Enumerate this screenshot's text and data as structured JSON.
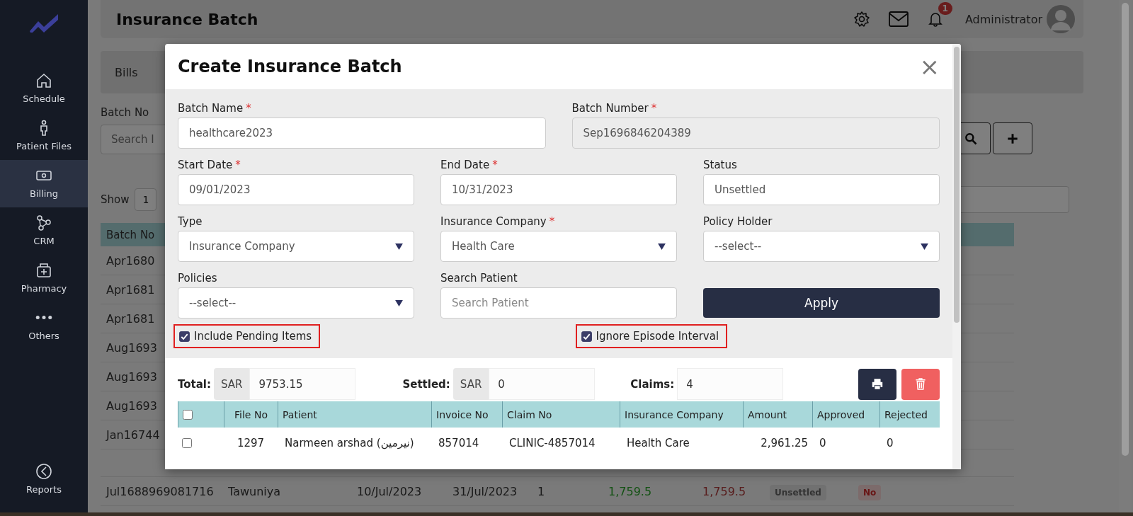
{
  "sidebar": {
    "items": [
      {
        "label": "Schedule",
        "selected": false
      },
      {
        "label": "Patient Files",
        "selected": false
      },
      {
        "label": "Billing",
        "selected": true
      },
      {
        "label": "CRM",
        "selected": false
      },
      {
        "label": "Pharmacy",
        "selected": false
      },
      {
        "label": "Others",
        "selected": false
      }
    ],
    "bottom_item": {
      "label": "Reports",
      "selected": false
    }
  },
  "header": {
    "title": "Insurance Batch",
    "notification_count": "1",
    "user": "Administrator"
  },
  "page": {
    "tab": "Bills",
    "filter_label": "Batch No",
    "search_placeholder": "Search I",
    "show_label": "Show",
    "show_value": "1",
    "table": {
      "column": "Batch No",
      "rows": [
        "Apr1680",
        "Apr1681",
        "Apr1681",
        "Aug1693",
        "Aug1693",
        "Aug1693",
        "Jan16744"
      ],
      "last_row": {
        "batch_no": "Jul1688969081716",
        "company": "Tawuniya",
        "start": "10/Jul/2023",
        "end": "31/Jul/2023",
        "claims": "1",
        "amount": "1,759.5",
        "approved": "1,759.5",
        "status": "Unsettled",
        "settled": "No"
      }
    }
  },
  "modal": {
    "title": "Create Insurance Batch",
    "close": "×",
    "rows": [
      [
        {
          "kind": "text",
          "label": "Batch Name",
          "required_mark": "*",
          "value": "healthcare2023"
        },
        {
          "kind": "disabled",
          "label": "Batch Number",
          "required_mark": "*",
          "value": "Sep1696846204389"
        }
      ],
      [
        {
          "kind": "text",
          "label": "Start Date",
          "required_mark": "*",
          "value": "09/01/2023"
        },
        {
          "kind": "text",
          "label": "End Date",
          "required_mark": "*",
          "value": "10/31/2023"
        },
        {
          "kind": "text",
          "label": "Status",
          "value": "Unsettled"
        }
      ],
      [
        {
          "kind": "select",
          "label": "Type",
          "value": "Insurance Company"
        },
        {
          "kind": "select",
          "label": "Insurance Company",
          "required_mark": "*",
          "value": "Health Care"
        },
        {
          "kind": "select",
          "label": "Policy Holder",
          "value": "--select--"
        }
      ],
      [
        {
          "kind": "select",
          "label": "Policies",
          "value": "--select--"
        },
        {
          "kind": "search",
          "label": "Search Patient",
          "placeholder": "Search Patient"
        },
        {
          "kind": "button",
          "label": "Apply"
        }
      ]
    ],
    "checkboxes": [
      {
        "label": "Include Pending Items",
        "checked": true,
        "highlighted": true
      },
      {
        "label": "Ignore Episode Interval",
        "checked": true,
        "highlighted": true
      }
    ],
    "totals": {
      "total_label": "Total:",
      "total_currency": "SAR",
      "total": "9753.15",
      "settled_label": "Settled:",
      "settled_currency": "SAR",
      "settled": "0",
      "claims_label": "Claims:",
      "claims": "4"
    },
    "table": {
      "select_all": false,
      "columns": [
        "File No",
        "Patient",
        "Invoice No",
        "Claim No",
        "Insurance Company",
        "Amount",
        "Approved",
        "Rejected"
      ],
      "rows": [
        {
          "checked": false,
          "cells": [
            "1297",
            "Narmeen arshad (نيرمين)",
            "857014",
            "CLINIC-4857014",
            "Health Care",
            "2,961.25",
            "0",
            "0"
          ]
        }
      ]
    }
  }
}
